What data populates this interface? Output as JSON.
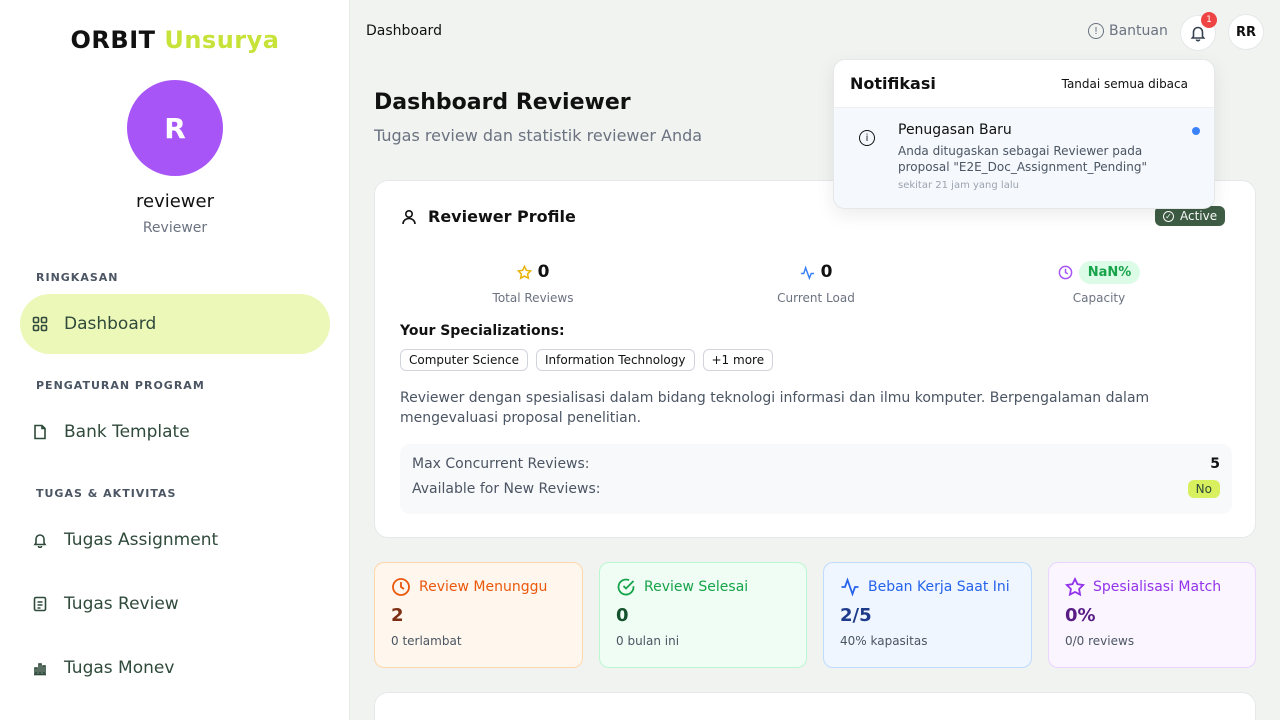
{
  "brand": {
    "part1": "ORBIT",
    "part2": "Unsurya"
  },
  "user": {
    "initial": "R",
    "name": "reviewer",
    "role": "Reviewer",
    "initials": "RR"
  },
  "sidebar": {
    "sections": [
      "RINGKASAN",
      "PENGATURAN PROGRAM",
      "TUGAS & AKTIVITAS"
    ],
    "items": [
      {
        "label": "Dashboard",
        "icon": "grid-icon",
        "active": true
      },
      {
        "label": "Bank Template",
        "icon": "file-icon"
      },
      {
        "label": "Tugas Assignment",
        "icon": "bell-icon"
      },
      {
        "label": "Tugas Review",
        "icon": "document-icon"
      },
      {
        "label": "Tugas Monev",
        "icon": "bar-chart-icon"
      }
    ]
  },
  "header": {
    "breadcrumb": "Dashboard",
    "help": "Bantuan",
    "notif_count": "1"
  },
  "page": {
    "title": "Dashboard Reviewer",
    "subtitle": "Tugas review dan statistik reviewer Anda"
  },
  "profile": {
    "title": "Reviewer Profile",
    "status": "Active",
    "stats": [
      {
        "value": "0",
        "label": "Total Reviews",
        "icon": "star-icon",
        "color": "#eab308"
      },
      {
        "value": "0",
        "label": "Current Load",
        "icon": "activity-icon",
        "color": "#3b82f6"
      },
      {
        "value": "NaN%",
        "label": "Capacity",
        "icon": "clock-icon",
        "color": "#a855f7"
      }
    ],
    "specializations_label": "Your Specializations:",
    "specializations": [
      "Computer Science",
      "Information Technology",
      "+1 more"
    ],
    "description": "Reviewer dengan spesialisasi dalam bidang teknologi informasi dan ilmu komputer. Berpengalaman dalam mengevaluasi proposal penelitian.",
    "max_label": "Max Concurrent Reviews:",
    "max_value": "5",
    "avail_label": "Available for New Reviews:",
    "avail_value": "No"
  },
  "stat_boxes": [
    {
      "title": "Review Menunggu",
      "value": "2",
      "sub": "0 terlambat",
      "icon": "clock-icon",
      "color": "#ea580c",
      "bg": "#fff7ed",
      "border": "#fed7aa",
      "value_color": "#7c2d12"
    },
    {
      "title": "Review Selesai",
      "value": "0",
      "sub": "0 bulan ini",
      "icon": "check-circle-icon",
      "color": "#16a34a",
      "bg": "#f0fdf4",
      "border": "#bbf7d0",
      "value_color": "#14532d"
    },
    {
      "title": "Beban Kerja Saat Ini",
      "value": "2/5",
      "sub": "40% kapasitas",
      "icon": "activity-icon",
      "color": "#2563eb",
      "bg": "#eff6ff",
      "border": "#bfdbfe",
      "value_color": "#1e3a8a"
    },
    {
      "title": "Spesialisasi Match",
      "value": "0%",
      "sub": "0/0 reviews",
      "icon": "star-icon",
      "color": "#9333ea",
      "bg": "#faf5ff",
      "border": "#e9d5ff",
      "value_color": "#581c87"
    }
  ],
  "notifications": {
    "title": "Notifikasi",
    "mark_all": "Tandai semua dibaca",
    "items": [
      {
        "title": "Penugasan Baru",
        "body": "Anda ditugaskan sebagai Reviewer pada proposal \"E2E_Doc_Assignment_Pending\"",
        "time": "sekitar 21 jam yang lalu",
        "unread": true
      }
    ]
  }
}
